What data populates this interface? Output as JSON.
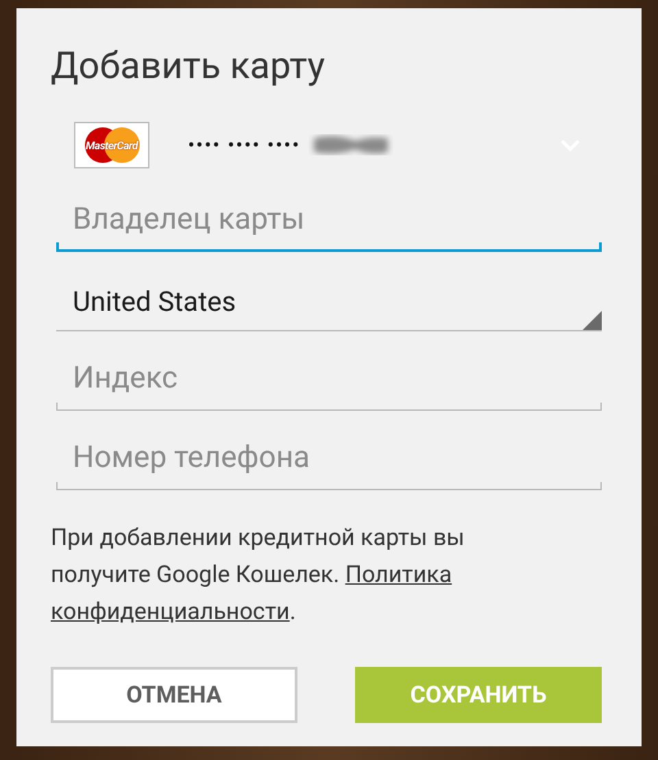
{
  "dialog": {
    "title": "Добавить карту"
  },
  "card": {
    "brand": "MasterCard",
    "number": "•••• •••• ••••"
  },
  "fields": [
    {
      "kind": "text",
      "placeholder": "Владелец карты",
      "focused": true
    },
    {
      "kind": "select",
      "value": "United States",
      "focused": false
    },
    {
      "kind": "text",
      "placeholder": "Индекс",
      "focused": false
    },
    {
      "kind": "text",
      "placeholder": "Номер телефона",
      "focused": false
    }
  ],
  "notice": {
    "text": "При добавлении кредитной карты вы получите Google Кошелек.",
    "link": [
      "Политика",
      "конфиденциальности"
    ],
    "end": "."
  },
  "buttons": [
    {
      "kind": "secondary",
      "label": "ОТМЕНА"
    },
    {
      "kind": "primary",
      "label": "СОХРАНИТЬ"
    }
  ]
}
